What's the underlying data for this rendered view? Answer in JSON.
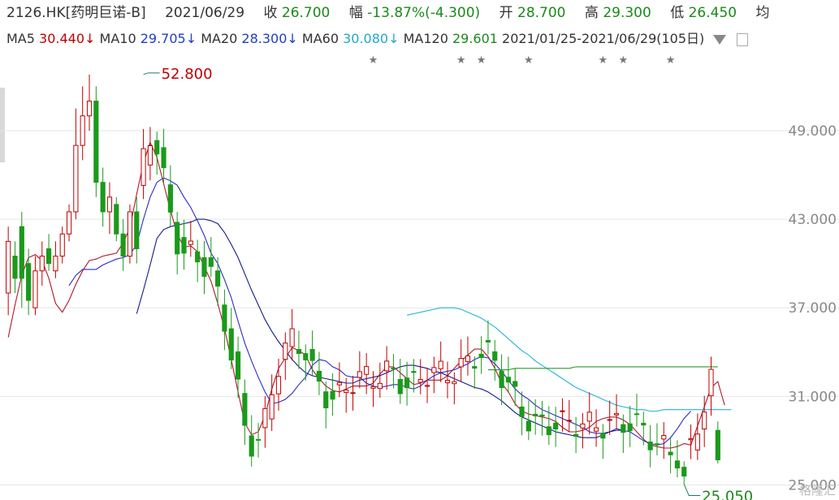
{
  "header": {
    "code": "2126.HK",
    "name": "[药明巨诺-B]",
    "date": "2021/06/29",
    "close_label": "收",
    "close_value": "26.700",
    "change_label": "幅",
    "change_value": "-13.87%(-4.300)",
    "open_label": "开",
    "open_value": "28.700",
    "high_label": "高",
    "high_value": "29.300",
    "low_label": "低",
    "low_value": "26.450",
    "avg_label": "均"
  },
  "ma_bar": {
    "ma5_label": "MA5",
    "ma5_value": "30.440↓",
    "ma10_label": "MA10",
    "ma10_value": "29.705↓",
    "ma20_label": "MA20",
    "ma20_value": "28.300↓",
    "ma60_label": "MA60",
    "ma60_value": "30.080↓",
    "ma120_label": "MA120",
    "ma120_value": "29.601",
    "range": "2021/01/25-2021/06/29(105日)"
  },
  "colors": {
    "up": "#c00000",
    "down": "#1a9a1a",
    "ma5": "#b0182c",
    "ma10": "#2b2bc8",
    "ma20": "#151a8a",
    "ma60": "#22b5d8",
    "ma120": "#2a9a2a",
    "grid": "#e6e6e6",
    "axis_text": "#888888"
  },
  "watermark": "格隆汇",
  "chart_data": {
    "type": "candlestick",
    "yaxis_ticks": [
      25.0,
      31.0,
      37.0,
      43.0,
      49.0
    ],
    "yaxis_labels": [
      "25.000",
      "31.000",
      "37.000",
      "43.000",
      "49.000"
    ],
    "ylim": [
      24.2,
      54.0
    ],
    "annotations": [
      {
        "label": "52.800",
        "index": 20,
        "value": 52.8,
        "type": "high"
      },
      {
        "label": "25.050",
        "index": 100,
        "value": 25.05,
        "type": "low"
      }
    ],
    "star_markers": [
      54,
      67,
      70,
      77,
      88,
      91,
      98
    ],
    "series": [
      {
        "name": "MA5",
        "values": [
          35.0,
          37.2,
          39.2,
          40.4,
          40.6,
          40.2,
          39.0,
          37.3,
          36.7,
          37.5,
          38.6,
          39.5,
          40.2,
          40.3,
          40.5,
          40.6,
          40.7,
          41.4,
          42.4,
          44.7,
          46.8,
          48.2,
          47.2,
          45.4,
          43.6,
          42.0,
          41.1,
          41.2,
          40.8,
          39.8,
          38.8,
          37.3,
          35.6,
          33.5,
          31.3,
          29.2,
          28.4,
          28.6,
          29.7,
          31.5,
          32.9,
          33.6,
          34.3,
          34.1,
          33.8,
          32.8,
          32.2,
          31.7,
          31.4,
          31.3,
          31.5,
          31.7,
          31.7,
          31.7,
          31.9,
          32.5,
          33.0,
          33.0,
          32.6,
          32.2,
          31.8,
          31.9,
          32.1,
          32.1,
          32.1,
          32.4,
          32.9,
          33.4,
          33.8,
          34.2,
          34.2,
          33.7,
          32.9,
          31.9,
          31.3,
          30.5,
          30.0,
          29.8,
          29.7,
          29.6,
          29.5,
          29.3,
          28.9,
          28.6,
          28.6,
          28.7,
          28.9,
          29.3,
          29.5,
          29.6,
          29.6,
          29.4,
          29.1,
          28.6,
          28.1,
          27.7,
          27.6,
          27.5,
          27.5,
          27.6,
          27.8,
          27.7,
          29.0,
          30.3,
          31.6,
          32.0,
          30.4
        ]
      },
      {
        "name": "MA10",
        "values": [
          null,
          null,
          null,
          null,
          null,
          null,
          null,
          null,
          null,
          38.5,
          39.2,
          39.6,
          39.6,
          39.6,
          39.9,
          40.1,
          40.3,
          40.4,
          40.6,
          41.3,
          43.0,
          44.5,
          45.5,
          45.8,
          45.6,
          45.3,
          44.5,
          43.8,
          42.9,
          41.9,
          40.7,
          40.0,
          38.9,
          37.7,
          36.1,
          34.6,
          33.4,
          32.3,
          31.3,
          30.5,
          30.6,
          30.8,
          31.2,
          31.8,
          32.3,
          33.1,
          33.5,
          33.4,
          33.0,
          32.8,
          32.4,
          32.3,
          32.3,
          31.9,
          31.7,
          31.6,
          31.7,
          31.8,
          31.8,
          31.6,
          31.5,
          31.7,
          32.1,
          32.4,
          32.6,
          32.7,
          32.8,
          33.0,
          33.2,
          33.5,
          33.7,
          33.6,
          33.2,
          32.7,
          32.1,
          31.5,
          31.1,
          30.8,
          30.4,
          30.1,
          29.9,
          29.7,
          29.5,
          29.3,
          29.1,
          28.9,
          28.6,
          28.5,
          28.5,
          28.6,
          28.7,
          28.7,
          28.6,
          28.3,
          28.0,
          27.8,
          27.7,
          27.8,
          28.2,
          28.8,
          29.5,
          30.0
        ]
      },
      {
        "name": "MA20",
        "values": [
          null,
          null,
          null,
          null,
          null,
          null,
          null,
          null,
          null,
          null,
          null,
          null,
          null,
          null,
          null,
          null,
          null,
          null,
          null,
          36.6,
          38.2,
          39.9,
          41.7,
          42.3,
          42.5,
          42.6,
          42.7,
          42.8,
          43.0,
          43.0,
          42.9,
          42.7,
          42.1,
          41.3,
          40.4,
          39.3,
          38.2,
          37.2,
          36.2,
          35.4,
          34.7,
          34.1,
          33.5,
          33.0,
          32.6,
          32.4,
          32.3,
          32.2,
          32.1,
          32.0,
          31.9,
          31.9,
          32.1,
          32.2,
          32.3,
          32.4,
          32.6,
          32.8,
          33.0,
          33.1,
          33.1,
          33.0,
          32.9,
          32.7,
          32.6,
          32.4,
          32.2,
          32.0,
          31.8,
          31.6,
          31.5,
          31.3,
          31.0,
          30.7,
          30.3,
          29.9,
          29.6,
          29.4,
          29.2,
          29.0,
          28.8,
          28.6,
          28.5,
          28.4,
          28.3,
          28.2,
          28.2,
          28.2,
          28.4,
          28.6,
          28.8,
          28.7
        ]
      },
      {
        "name": "MA60",
        "values": [
          null,
          null,
          null,
          null,
          null,
          null,
          null,
          null,
          null,
          null,
          null,
          null,
          null,
          null,
          null,
          null,
          null,
          null,
          null,
          null,
          null,
          null,
          null,
          null,
          null,
          null,
          null,
          null,
          null,
          null,
          null,
          null,
          null,
          null,
          null,
          null,
          null,
          null,
          null,
          null,
          null,
          null,
          null,
          null,
          null,
          null,
          null,
          null,
          null,
          null,
          null,
          null,
          null,
          null,
          null,
          null,
          null,
          null,
          null,
          36.5,
          36.6,
          36.7,
          36.8,
          36.9,
          37.0,
          37.0,
          37.0,
          36.9,
          36.7,
          36.5,
          36.3,
          36.0,
          35.7,
          35.3,
          34.9,
          34.5,
          34.1,
          33.8,
          33.4,
          33.1,
          32.8,
          32.5,
          32.2,
          31.9,
          31.6,
          31.4,
          31.2,
          31.0,
          30.8,
          30.6,
          30.4,
          30.3,
          30.2,
          30.1,
          30.1,
          30.0,
          30.0,
          30.1,
          30.1,
          30.1,
          30.1,
          30.1,
          30.1,
          30.1,
          30.1,
          30.1,
          30.1,
          30.1
        ]
      },
      {
        "name": "MA120",
        "values": [
          null,
          null,
          null,
          null,
          null,
          null,
          null,
          null,
          null,
          null,
          null,
          null,
          null,
          null,
          null,
          null,
          null,
          null,
          null,
          null,
          null,
          null,
          null,
          null,
          null,
          null,
          null,
          null,
          null,
          null,
          null,
          null,
          null,
          null,
          null,
          null,
          null,
          null,
          null,
          null,
          null,
          null,
          null,
          null,
          null,
          null,
          null,
          null,
          null,
          null,
          null,
          null,
          null,
          null,
          null,
          null,
          null,
          null,
          null,
          null,
          null,
          null,
          null,
          null,
          null,
          null,
          null,
          null,
          null,
          null,
          null,
          32.8,
          32.8,
          32.8,
          32.8,
          32.9,
          32.9,
          32.9,
          32.9,
          32.9,
          32.9,
          32.9,
          32.9,
          32.9,
          33.0,
          33.0,
          33.0,
          33.0,
          33.0,
          33.0,
          33.0,
          33.0,
          33.0,
          33.0,
          33.0,
          33.0,
          33.0,
          33.0,
          33.0,
          33.0,
          33.0,
          33.0,
          33.0,
          33.0,
          33.0,
          33.0
        ]
      }
    ],
    "candles": [
      [
        38.0,
        41.5,
        36.5,
        42.5
      ],
      [
        40.5,
        39.0,
        38.0,
        41.5
      ],
      [
        42.5,
        39.0,
        37.0,
        43.5
      ],
      [
        40.0,
        37.5,
        36.5,
        41.0
      ],
      [
        37.0,
        39.5,
        36.5,
        40.5
      ],
      [
        39.5,
        40.5,
        38.5,
        41.5
      ],
      [
        41.0,
        40.0,
        39.5,
        42.0
      ],
      [
        39.5,
        40.5,
        39.0,
        41.5
      ],
      [
        40.5,
        42.0,
        40.0,
        42.5
      ],
      [
        42.0,
        43.5,
        41.5,
        44.0
      ],
      [
        43.5,
        48.0,
        43.0,
        50.5
      ],
      [
        48.0,
        50.0,
        47.0,
        52.0
      ],
      [
        50.0,
        51.0,
        49.0,
        52.8
      ],
      [
        51.0,
        45.5,
        44.5,
        52.0
      ],
      [
        45.5,
        43.5,
        42.5,
        46.5
      ],
      [
        43.5,
        44.5,
        42.0,
        45.5
      ],
      [
        44.0,
        42.0,
        41.5,
        44.5
      ],
      [
        42.0,
        40.5,
        39.5,
        43.0
      ],
      [
        40.5,
        43.5,
        40.0,
        44.0
      ],
      [
        43.5,
        41.0,
        40.0,
        44.5
      ]
    ]
  }
}
